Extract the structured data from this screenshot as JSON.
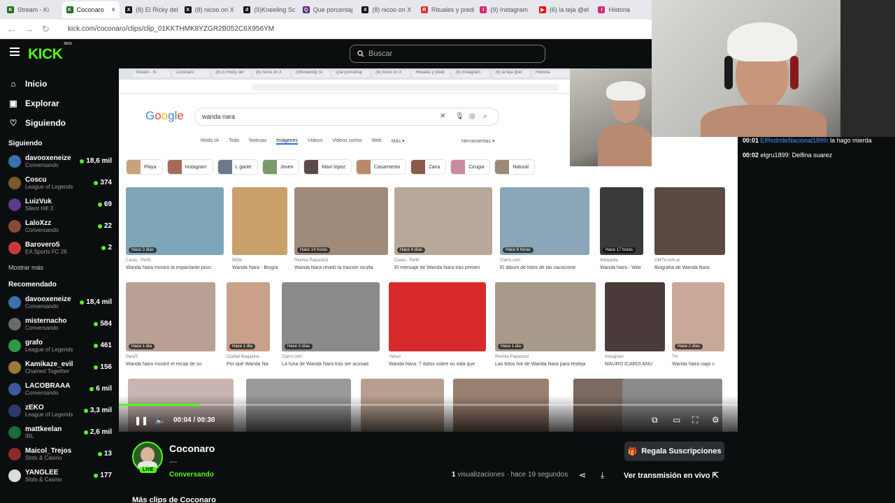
{
  "browser": {
    "tabs": [
      {
        "label": "Stream - Ki",
        "color": "#1f6e1a",
        "glyph": "K"
      },
      {
        "label": "Coconaro",
        "color": "#1f6e1a",
        "glyph": "K"
      },
      {
        "label": "(8) El Ricky del",
        "color": "#111111",
        "glyph": "X"
      },
      {
        "label": "(8) nicoo on X",
        "color": "#111111",
        "glyph": "X"
      },
      {
        "label": "(9)Kneeling Sc",
        "color": "#111111",
        "glyph": "d"
      },
      {
        "label": "Que porcentaj",
        "color": "#5b2a7a",
        "glyph": "Q"
      },
      {
        "label": "(8) nicoo on X",
        "color": "#111111",
        "glyph": "X"
      },
      {
        "label": "Rituales y predi",
        "color": "#d93025",
        "glyph": "R"
      },
      {
        "label": "(9) Instagram",
        "color": "#d62976",
        "glyph": "I"
      },
      {
        "label": "(6) la teja @el",
        "color": "#ff0000",
        "glyph": "▶"
      },
      {
        "label": "Historia",
        "color": "#d62976",
        "glyph": "I"
      }
    ],
    "close_glyph": "×",
    "url": "kick.com/coconaro/clips/clip_01KKTHMK8YZGR2B052C6X956YM"
  },
  "header": {
    "logo": "KICK",
    "logo_beta": "BETA",
    "search_placeholder": "Buscar"
  },
  "sidebar": {
    "nav": [
      {
        "label": "Inicio",
        "icon": "⌂"
      },
      {
        "label": "Explorar",
        "icon": "▣"
      },
      {
        "label": "Siguiendo",
        "icon": "♡"
      }
    ],
    "following_title": "Siguiendo",
    "following": [
      {
        "name": "davooxeneize",
        "game": "Conversando",
        "viewers": "18,6 mil",
        "avatar": "#3a6fb0"
      },
      {
        "name": "Coscu",
        "game": "League of Legends",
        "viewers": "374",
        "avatar": "#7a5a2a"
      },
      {
        "name": "LuizVuk",
        "game": "Silent Hill 3",
        "viewers": "69",
        "avatar": "#5a3a8a"
      },
      {
        "name": "LaloXzz",
        "game": "Conversando",
        "viewers": "22",
        "avatar": "#8a4a3a"
      },
      {
        "name": "Barovero5",
        "game": "EA Sports FC 26",
        "viewers": "2",
        "avatar": "#c83a3a"
      }
    ],
    "show_more": "Mostrar más",
    "recommended_title": "Recomendado",
    "recommended": [
      {
        "name": "davooxeneize",
        "game": "Conversando",
        "viewers": "18,4 mil",
        "avatar": "#3a6fb0"
      },
      {
        "name": "misternacho",
        "game": "Conversando",
        "viewers": "584",
        "avatar": "#6a6a6a"
      },
      {
        "name": "grafo",
        "game": "League of Legends",
        "viewers": "461",
        "avatar": "#2a9a4a"
      },
      {
        "name": "Kamikaze_evil",
        "game": "Chained Together",
        "viewers": "156",
        "avatar": "#9a7a3a"
      },
      {
        "name": "LACOBRAAA",
        "game": "Conversando",
        "viewers": "6 mil",
        "avatar": "#3a5a9a"
      },
      {
        "name": "zEKO",
        "game": "League of Legends",
        "viewers": "3,3 mil",
        "avatar": "#2a3a6a"
      },
      {
        "name": "mattkeelan",
        "game": "IRL",
        "viewers": "2,6 mil",
        "avatar": "#1a6a3a"
      },
      {
        "name": "Maicol_Trejos",
        "game": "Slots & Casino",
        "viewers": "13",
        "avatar": "#8a2a2a"
      },
      {
        "name": "YANGLEE",
        "game": "Slots & Casino",
        "viewers": "177",
        "avatar": "#dcdcdc"
      }
    ]
  },
  "google": {
    "logo": "Google",
    "query": "wanda nara",
    "filters": [
      "Modo IA",
      "Todo",
      "Noticias",
      "Imágenes",
      "Videos",
      "Videos cortos",
      "Web",
      "Más ▾"
    ],
    "tools": "Herramientas ▾",
    "chips": [
      {
        "label": "Playa",
        "color": "#c9a27a"
      },
      {
        "label": "Instagram",
        "color": "#a66a5a"
      },
      {
        "label": "L gante",
        "color": "#6a7a8a"
      },
      {
        "label": "Joven",
        "color": "#7a9a6a"
      },
      {
        "label": "Maxi lopez",
        "color": "#5a4a4a"
      },
      {
        "label": "Casamiento",
        "color": "#b88a6a"
      },
      {
        "label": "Zaira",
        "color": "#8a5a4a"
      },
      {
        "label": "Cirugia",
        "color": "#c98aa0"
      },
      {
        "label": "Natural",
        "color": "#9a8a7a"
      }
    ],
    "row1": [
      {
        "badge": "Hace 3 días",
        "source": "Caras - Perfil",
        "caption": "Wanda Nara mostró la impactante pisci",
        "color": "#7fa6b8"
      },
      {
        "badge": "",
        "source": "IMDb",
        "caption": "Wanda Nara - Biogra",
        "color": "#c9a06a"
      },
      {
        "badge": "Hace 14 horas",
        "source": "Revista Paparazzi",
        "caption": "Wanda Nara reveló la traición oculta",
        "color": "#a08a7a"
      },
      {
        "badge": "Hace 4 días",
        "source": "Caras - Perfil",
        "caption": "El mensaje de Wanda Nara tras presen",
        "color": "#b8a89a"
      },
      {
        "badge": "Hace 6 horas",
        "source": "Clarín.com",
        "caption": "El álbum de fotos de las vacacione",
        "color": "#8aa6b8"
      },
      {
        "badge": "Hace 17 horas",
        "source": "Wikipedia",
        "caption": "Wanda Nara - Wiki",
        "color": "#3a3a3a"
      },
      {
        "badge": "",
        "source": "CMTV.com.ar",
        "caption": "Biografía de Wanda Nara",
        "color": "#5a4a42"
      }
    ],
    "row2": [
      {
        "badge": "Hace 1 día",
        "source": "ParaTi",
        "caption": "Wanda Nara mostró el recap de su",
        "color": "#b8a094"
      },
      {
        "badge": "Hace 1 día",
        "source": "Ciudad Magazine",
        "caption": "Por qué Wanda Na",
        "color": "#c9a08a"
      },
      {
        "badge": "Hace 3 días",
        "source": "Clarín.com",
        "caption": "La furia de Wanda Nara tras ser acusad",
        "color": "#8a8a8a"
      },
      {
        "badge": "",
        "source": "Yahoo",
        "caption": "Wanda Nara: 7 datos sobre su vida que",
        "color": "#d82a2a"
      },
      {
        "badge": "Hace 1 día",
        "source": "Revista Paparazzi",
        "caption": "Las fotos hot de Wanda Nara para festeja",
        "color": "#a89a8a"
      },
      {
        "badge": "",
        "source": "Instagram",
        "caption": "MAURO ICARDI ANU",
        "color": "#4a3a3a"
      },
      {
        "badge": "Hace 2 días",
        "source": "TN",
        "caption": "Wanda Nara viajó c",
        "color": "#c8a898"
      }
    ],
    "row3_colors": [
      "#c8b4b0",
      "#9a9a9a",
      "#b8a090",
      "#9a8070",
      "#7a6a60",
      "#6a8aa0",
      "#8a8a8a"
    ]
  },
  "player": {
    "time": "00:04 / 00:30",
    "progress": 0.13
  },
  "chat": {
    "messages": [
      {
        "ts": "00:01",
        "user": "ElRodrideNacional1899",
        "text": ": la hago mierda",
        "user_color": "#4a90ff"
      },
      {
        "ts": "00:02",
        "user": "elgru1899",
        "text": ": Delfina suarez",
        "user_color": "#ffffff"
      }
    ]
  },
  "clip": {
    "channel": "Coconaro",
    "title": "....",
    "category": "Conversando",
    "live_badge": "LIVE",
    "gift_button": "Regala Suscripciones",
    "views_count": "1",
    "views_label": " visualizaciones",
    "time_ago": " · hace 19 segundos",
    "watch_live": "Ver transmisión en vivo",
    "more_clips": "Más clips de Coconaro"
  },
  "colors": {
    "kick_green": "#53fc18",
    "bg": "#0b0e0f"
  }
}
